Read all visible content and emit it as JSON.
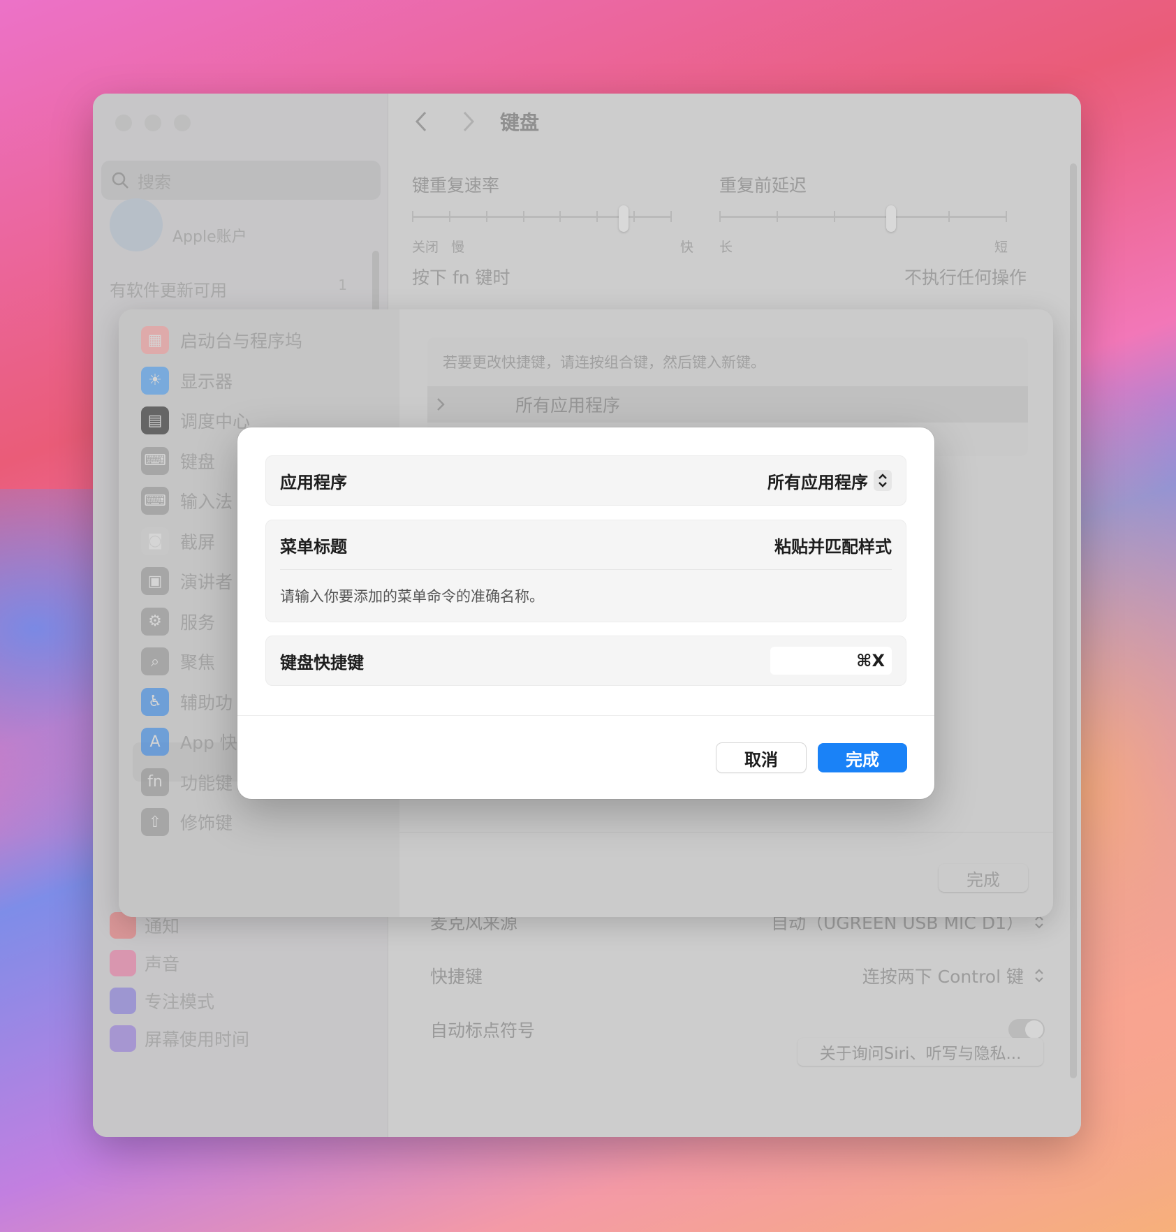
{
  "sidebar": {
    "search_placeholder": "搜索",
    "profile_sub": "Apple账户",
    "update_label": "有软件更新可用",
    "update_badge": "1",
    "lower_items": [
      "通知",
      "声音",
      "专注模式",
      "屏幕使用时间"
    ]
  },
  "main": {
    "title": "键盘",
    "repeat_rate": {
      "title": "键重复速率",
      "labels": [
        "关闭",
        "慢",
        "快"
      ],
      "level": 0.82
    },
    "delay": {
      "title": "重复前延迟",
      "labels": [
        "长",
        "短"
      ],
      "level": 0.6
    },
    "fn_row": {
      "label": "按下 fn 键时",
      "value": "不执行任何操作"
    },
    "rows": [
      {
        "label": "麦克风来源",
        "value": "自动（UGREEN USB MIC D1）"
      },
      {
        "label": "快捷键",
        "value": "连按两下 Control 键"
      },
      {
        "label": "自动标点符号",
        "value": ""
      }
    ],
    "privacy_button": "关于询问Siri、听写与隐私..."
  },
  "sheet": {
    "items": [
      {
        "label": "启动台与程序坞",
        "icon": "launchpad-icon",
        "color": "#e9a0a0"
      },
      {
        "label": "显示器",
        "icon": "display-icon",
        "color": "#5aa0e6"
      },
      {
        "label": "调度中心",
        "icon": "mission-control-icon",
        "color": "#3d3d3d"
      },
      {
        "label": "键盘",
        "icon": "keyboard-icon",
        "color": "#9a9a9a"
      },
      {
        "label": "输入法",
        "icon": "input-method-icon",
        "color": "#9a9a9a"
      },
      {
        "label": "截屏",
        "icon": "screenshot-icon",
        "color": "#c8c8c8"
      },
      {
        "label": "演讲者",
        "icon": "presenter-icon",
        "color": "#9a9a9a"
      },
      {
        "label": "服务",
        "icon": "services-icon",
        "color": "#9a9a9a"
      },
      {
        "label": "聚焦",
        "icon": "spotlight-icon",
        "color": "#9a9a9a"
      },
      {
        "label": "辅助功",
        "icon": "accessibility-icon",
        "color": "#4a8fe0"
      },
      {
        "label": "App 快",
        "icon": "app-store-icon",
        "color": "#4a8fe0"
      },
      {
        "label": "功能键",
        "icon": "fn-icon",
        "color": "#9a9a9a"
      },
      {
        "label": "修饰键",
        "icon": "modifier-icon",
        "color": "#9a9a9a"
      }
    ],
    "hint": "若要更改快捷键，请连按组合键，然后键入新键。",
    "group_label": "所有应用程序",
    "done": "完成"
  },
  "dialog": {
    "app_label": "应用程序",
    "app_value": "所有应用程序",
    "menu_label": "菜单标题",
    "menu_value": "粘贴并匹配样式",
    "menu_note": "请输入你要添加的菜单命令的准确名称。",
    "shortcut_label": "键盘快捷键",
    "shortcut_value": "⌘X",
    "cancel": "取消",
    "done": "完成",
    "accent": "#1a82f7"
  }
}
